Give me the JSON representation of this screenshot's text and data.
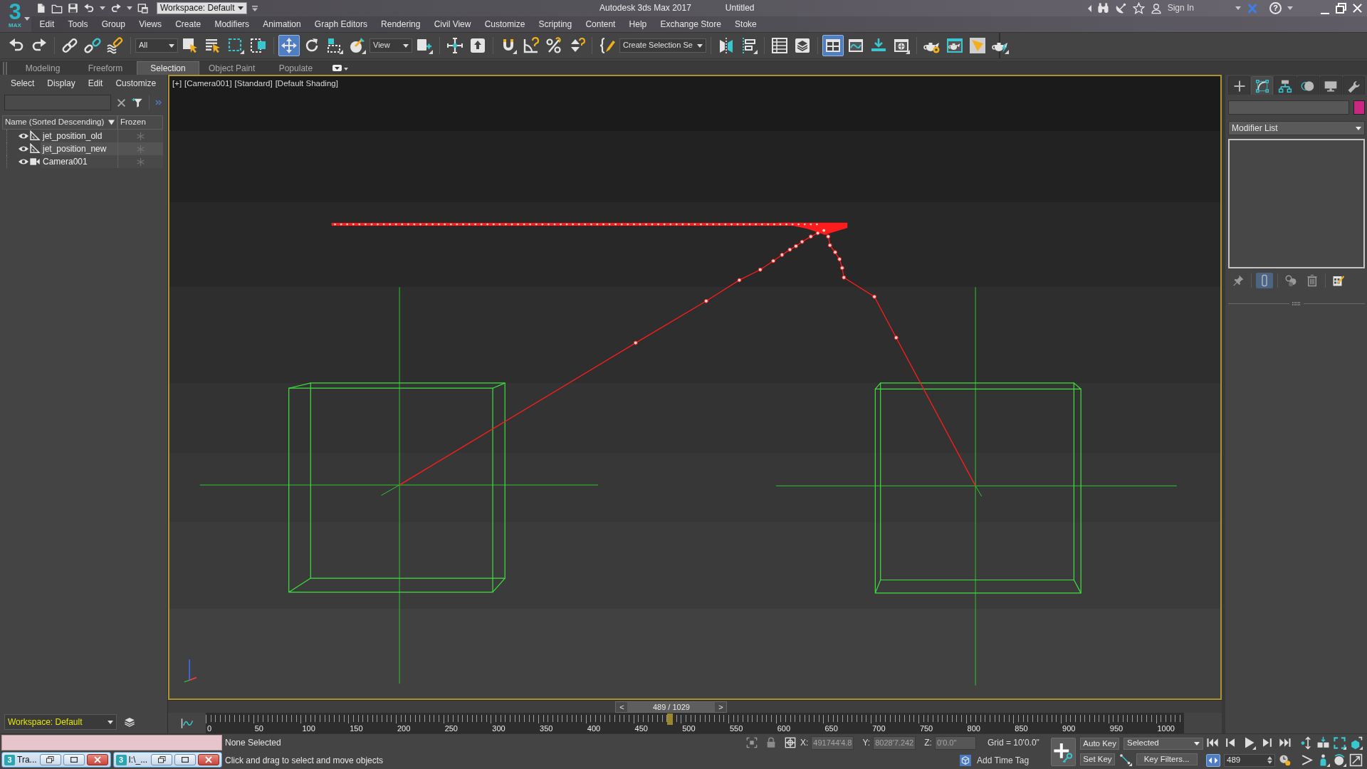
{
  "title_bar": {
    "logo_numeral": "3",
    "logo_caption": "MAX",
    "workspace": "Workspace: Default",
    "app": "Autodesk 3ds Max 2017",
    "document": "Untitled",
    "sign_in": "Sign In",
    "help": "?"
  },
  "menu": [
    "Edit",
    "Tools",
    "Group",
    "Views",
    "Create",
    "Modifiers",
    "Animation",
    "Graph Editors",
    "Rendering",
    "Civil View",
    "Customize",
    "Scripting",
    "Content",
    "Help",
    "Exchange Store",
    "Stoke"
  ],
  "toolbar": [
    {
      "kind": "undo",
      "selected": false
    },
    {
      "kind": "redo",
      "selected": false
    },
    {
      "kind": "separator"
    },
    {
      "kind": "link",
      "selected": false
    },
    {
      "kind": "unlink",
      "selected": false
    },
    {
      "kind": "bindwarp",
      "selected": false
    },
    {
      "kind": "separator"
    },
    {
      "kind": "dropdown",
      "value": "All"
    },
    {
      "kind": "selectobject",
      "selected": false
    },
    {
      "kind": "selectbyname",
      "selected": false
    },
    {
      "kind": "rectregion",
      "selected": false
    },
    {
      "kind": "crossing",
      "selected": false
    },
    {
      "kind": "separator"
    },
    {
      "kind": "move",
      "selected": true
    },
    {
      "kind": "rotate",
      "selected": false
    },
    {
      "kind": "scale",
      "selected": false
    },
    {
      "kind": "place",
      "selected": false
    },
    {
      "kind": "dropdown",
      "value": "View"
    },
    {
      "kind": "pivot",
      "selected": false
    },
    {
      "kind": "separator"
    },
    {
      "kind": "manipulate",
      "selected": false
    },
    {
      "kind": "keyboard",
      "selected": false
    },
    {
      "kind": "separator"
    },
    {
      "kind": "snap",
      "selected": false
    },
    {
      "kind": "anglesnap",
      "selected": false
    },
    {
      "kind": "percentsnap",
      "selected": false
    },
    {
      "kind": "spinnersnap",
      "selected": false
    },
    {
      "kind": "separator"
    },
    {
      "kind": "namedsel",
      "selected": false
    },
    {
      "kind": "dropdown",
      "value": "Create Selection Se"
    },
    {
      "kind": "separator"
    },
    {
      "kind": "mirror",
      "selected": false
    },
    {
      "kind": "align",
      "selected": false
    },
    {
      "kind": "separator"
    },
    {
      "kind": "sceneexplorer",
      "selected": false
    },
    {
      "kind": "layerexplorer",
      "selected": false
    },
    {
      "kind": "separator"
    },
    {
      "kind": "ribbon",
      "selected": true
    },
    {
      "kind": "curveeditor",
      "selected": false
    },
    {
      "kind": "schematic",
      "selected": false
    },
    {
      "kind": "material",
      "selected": false
    },
    {
      "kind": "separator"
    },
    {
      "kind": "rendersetup",
      "selected": false
    },
    {
      "kind": "framewindow",
      "selected": false
    },
    {
      "kind": "render",
      "selected": false
    },
    {
      "kind": "renderiterative",
      "selected": false
    }
  ],
  "ribbon_tabs": [
    {
      "label": "Modeling",
      "selected": false
    },
    {
      "label": "Freeform",
      "selected": false
    },
    {
      "label": "Selection",
      "selected": true
    },
    {
      "label": "Object Paint",
      "selected": false
    },
    {
      "label": "Populate",
      "selected": false
    }
  ],
  "scene_explorer": {
    "menu": [
      "Select",
      "Display",
      "Edit",
      "Customize"
    ],
    "columns": [
      "Name (Sorted Descending)",
      "Frozen"
    ],
    "rows": [
      {
        "name": "jet_position_old",
        "kind": "shape",
        "visible": true,
        "frozen": false
      },
      {
        "name": "jet_position_new",
        "kind": "shape",
        "visible": true,
        "frozen": false
      },
      {
        "name": "Camera001",
        "kind": "camera",
        "visible": true,
        "frozen": false
      }
    ],
    "workspace": "Workspace: Default"
  },
  "viewport": {
    "labels": [
      "[+]",
      "[Camera001]",
      "[Standard]",
      "[Default Shading]"
    ]
  },
  "time_slider": {
    "prev": "<",
    "label": "489 / 1029",
    "next": ">",
    "level": 0.475
  },
  "track_bar": {
    "labels": [
      "0",
      "50",
      "100",
      "150",
      "200",
      "250",
      "300",
      "350",
      "400",
      "450",
      "500",
      "550",
      "600",
      "650",
      "700",
      "750",
      "800",
      "850",
      "900",
      "950",
      "1000"
    ]
  },
  "command_panel": {
    "tabs": [
      {
        "kind": "create",
        "selected": false
      },
      {
        "kind": "modify",
        "selected": true
      },
      {
        "kind": "hierarchy",
        "selected": false
      },
      {
        "kind": "motion",
        "selected": false
      },
      {
        "kind": "display",
        "selected": false
      },
      {
        "kind": "utilities",
        "selected": false
      }
    ],
    "modifier_list": "Modifier List",
    "stack_tools": [
      {
        "kind": "pin",
        "selected": false
      },
      {
        "kind": "endresult",
        "selected": true
      },
      {
        "kind": "unique",
        "selected": false
      },
      {
        "kind": "remove",
        "selected": false
      },
      {
        "kind": "configure",
        "selected": false
      }
    ]
  },
  "status_bar": {
    "windows": [
      {
        "icon": "3",
        "title": "Tra..."
      },
      {
        "icon": "3",
        "title": "I:\\_..."
      }
    ],
    "selection": "None Selected",
    "prompt": "Click and drag to select and move objects",
    "coords": [
      {
        "label": "X:",
        "value": "491744'4.8",
        "disabled": true
      },
      {
        "label": "Y:",
        "value": "8028'7.242",
        "disabled": true
      },
      {
        "label": "Z:",
        "value": "0'0.0\"",
        "disabled": true
      }
    ],
    "grid": "Grid = 10'0.0\"",
    "time_tag": "Add Time Tag",
    "auto_key": "Auto Key",
    "set_key": "Set Key",
    "key_set": "Selected",
    "key_filters": "Key Filters...",
    "key_mode": true,
    "frame": "489"
  }
}
